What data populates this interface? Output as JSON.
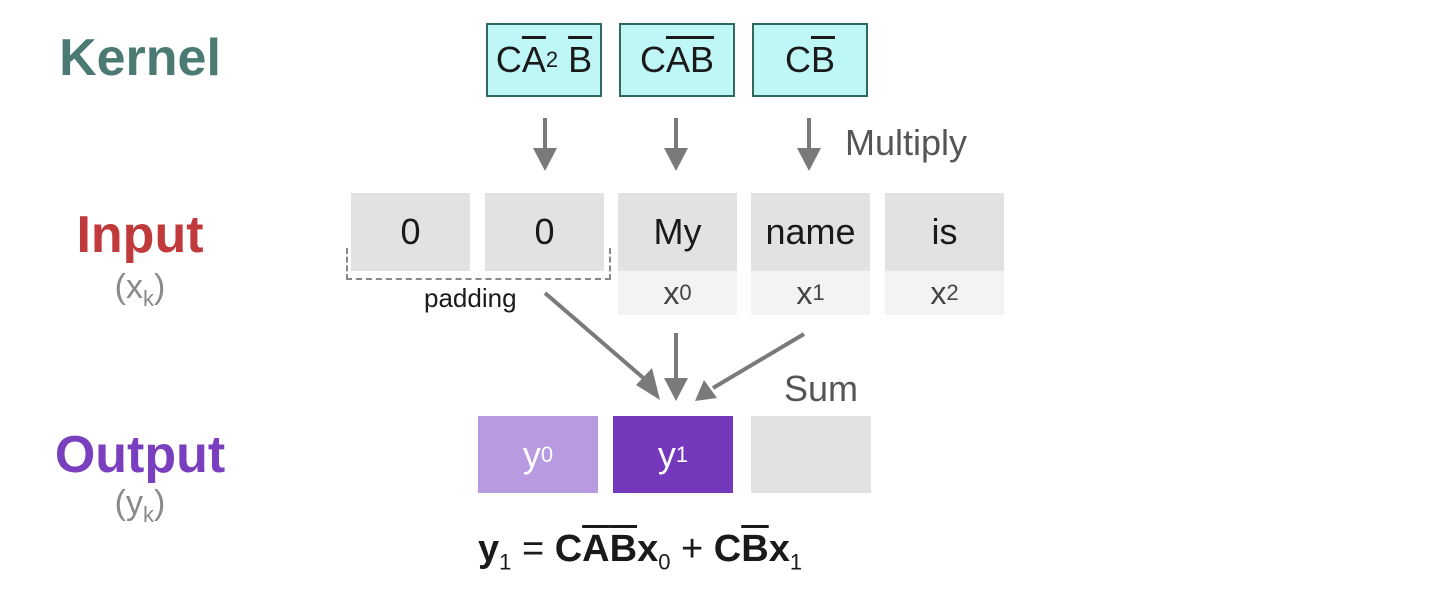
{
  "labels": {
    "kernel": {
      "title": "Kernel",
      "color": "#4a7a72"
    },
    "input": {
      "title": "Input",
      "sub_var": "x",
      "sub_index": "k",
      "color": "#c0393b"
    },
    "output": {
      "title": "Output",
      "sub_var": "y",
      "sub_index": "k",
      "color": "#7a3fbf"
    }
  },
  "kernel_boxes": [
    {
      "base": "C",
      "bar_part": "A",
      "exp": "2",
      "tail_bar": "B"
    },
    {
      "base": "C",
      "bar_part": "A",
      "tail_bar": "B"
    },
    {
      "base": "C",
      "tail_bar": "B"
    }
  ],
  "input_tokens": [
    {
      "token": "0",
      "var": "",
      "index": ""
    },
    {
      "token": "0",
      "var": "",
      "index": ""
    },
    {
      "token": "My",
      "var": "x",
      "index": "0"
    },
    {
      "token": "name",
      "var": "x",
      "index": "1"
    },
    {
      "token": "is",
      "var": "x",
      "index": "2"
    }
  ],
  "padding_label": "padding",
  "multiply_label": "Multiply",
  "sum_label": "Sum",
  "output_boxes": [
    {
      "var": "y",
      "index": "0",
      "color": "#b89ae0"
    },
    {
      "var": "y",
      "index": "1",
      "color": "#7438bd"
    },
    {
      "var": "",
      "index": "",
      "color": "#e2e2e2"
    }
  ],
  "formula": {
    "lhs_var": "y",
    "lhs_index": "1",
    "eq": "=",
    "t1_c": "C",
    "t1_a": "A",
    "t1_b": "B",
    "t1_x": "x",
    "t1_i": "0",
    "plus": "+",
    "t2_c": "C",
    "t2_b": "B",
    "t2_x": "x",
    "t2_i": "1"
  }
}
